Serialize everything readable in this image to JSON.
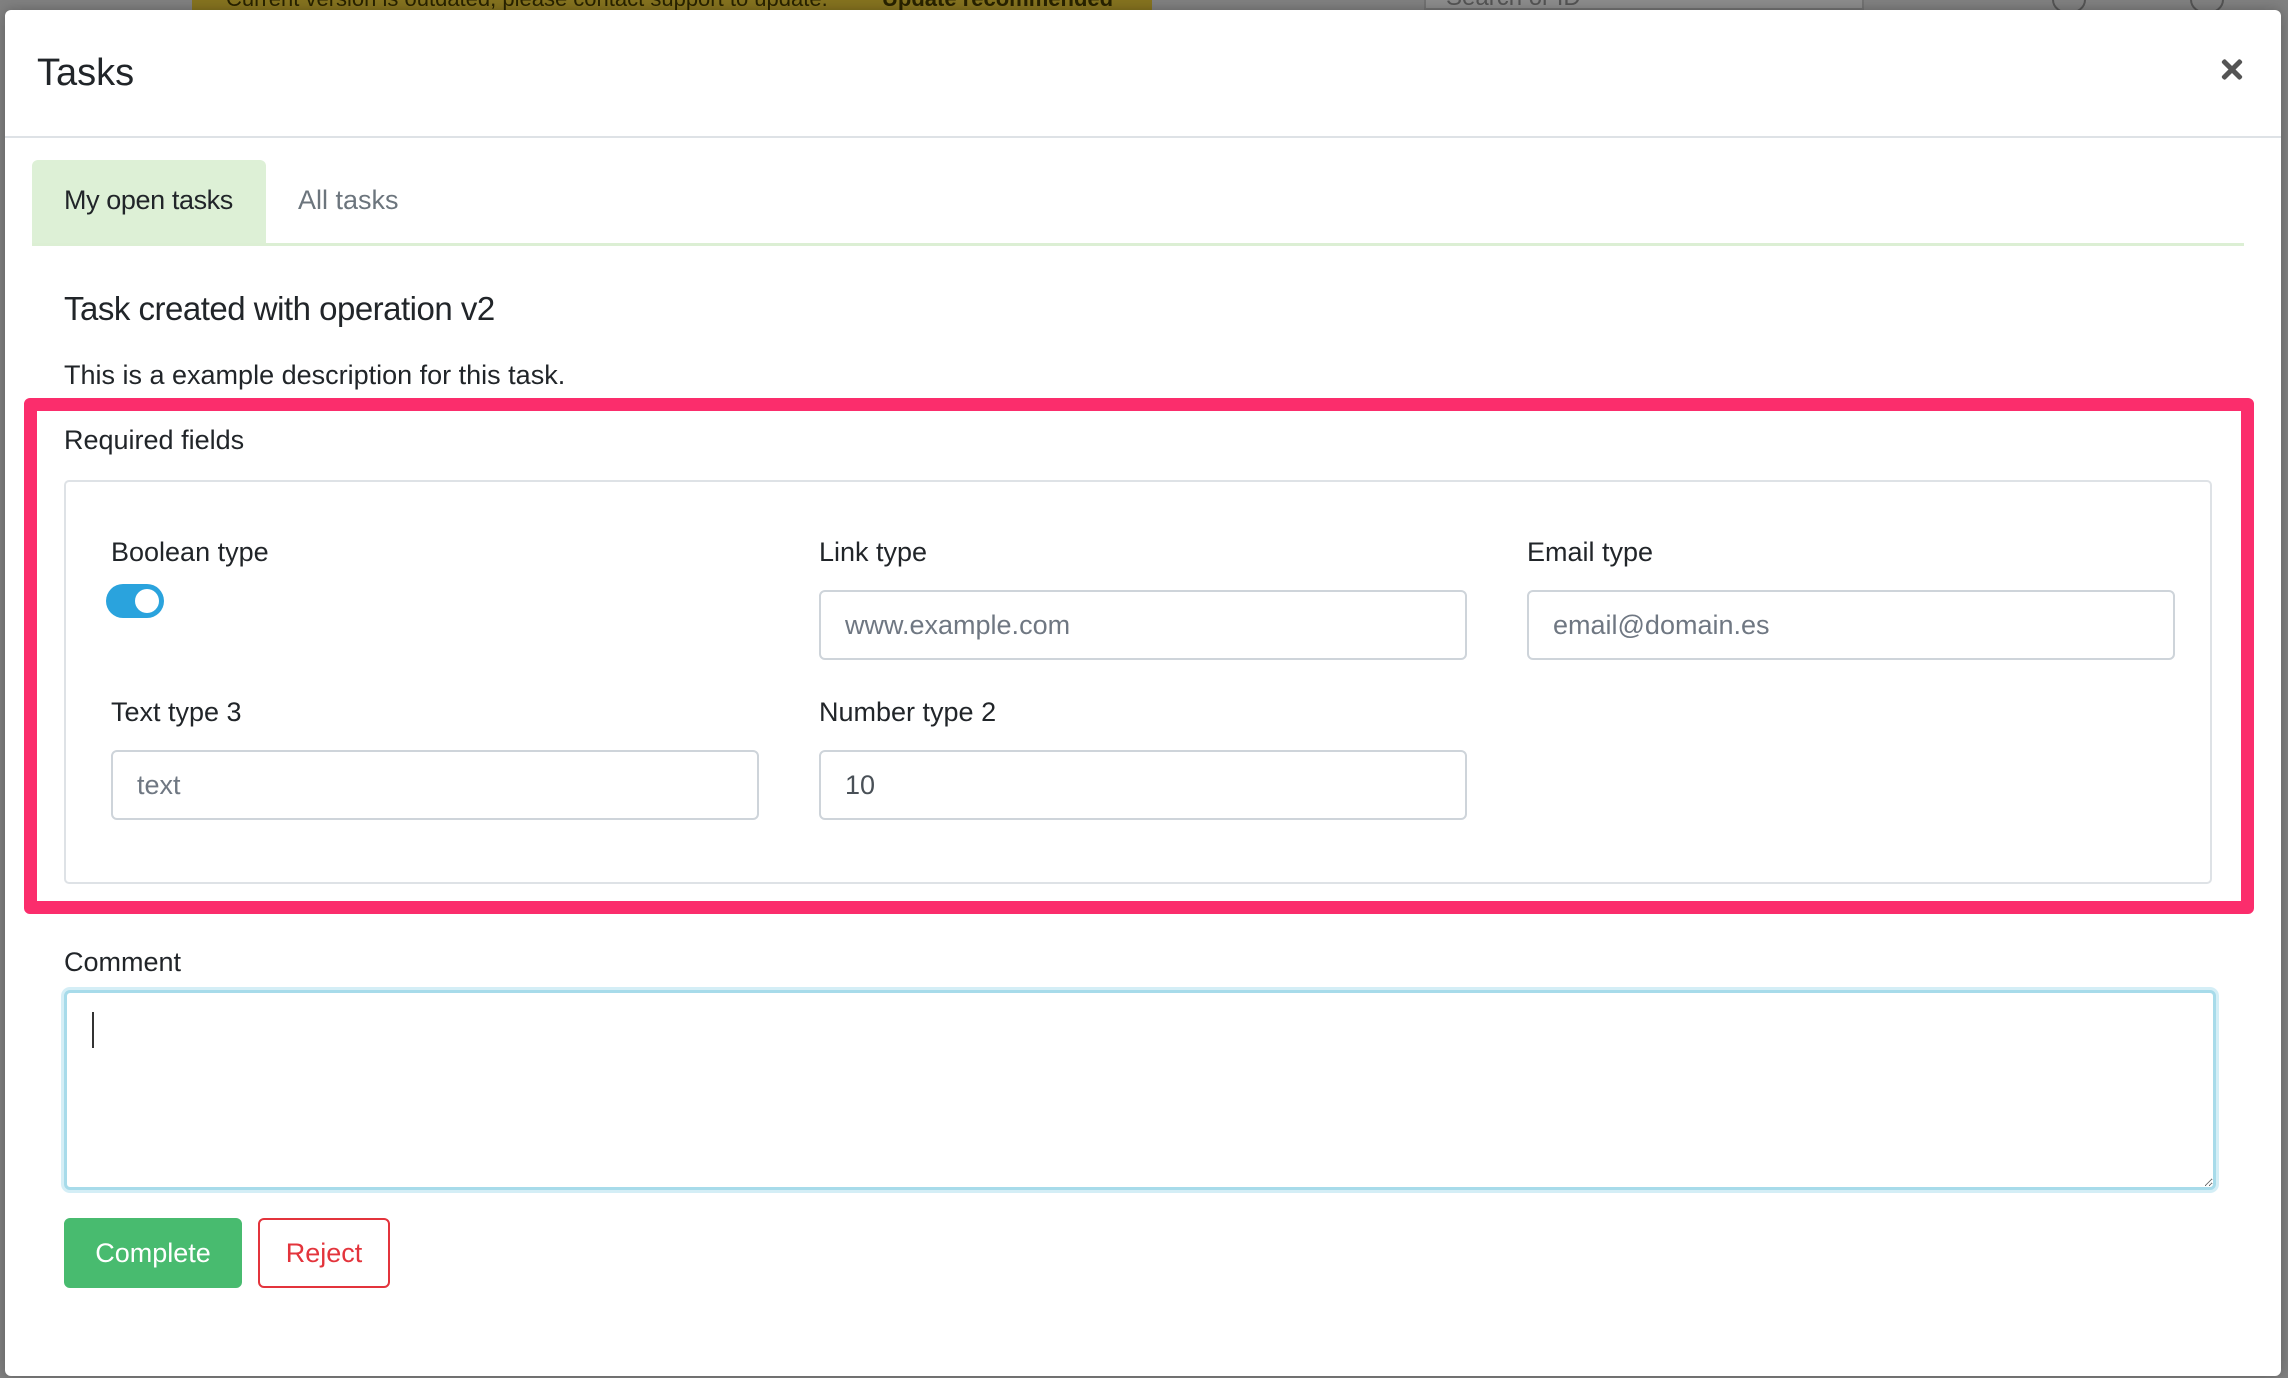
{
  "background": {
    "banner_text": "Current version is outdated, please contact support to update.",
    "banner_badge": "Update recommended",
    "search_placeholder": "Search or ID"
  },
  "modal": {
    "title": "Tasks",
    "close_icon": "close-icon"
  },
  "tabs": [
    {
      "label": "My open tasks",
      "active": true
    },
    {
      "label": "All tasks",
      "active": false
    }
  ],
  "task": {
    "title": "Task created with operation v2",
    "description": "This is a example description for this task."
  },
  "required_fields": {
    "label": "Required fields",
    "boolean_field": {
      "label": "Boolean type",
      "value": true
    },
    "link_field": {
      "label": "Link type",
      "placeholder": "www.example.com",
      "value": ""
    },
    "email_field": {
      "label": "Email type",
      "placeholder": "email@domain.es",
      "value": ""
    },
    "text_field": {
      "label": "Text type 3",
      "placeholder": "text",
      "value": ""
    },
    "number_field": {
      "label": "Number type 2",
      "placeholder": "",
      "value": "10"
    }
  },
  "comment": {
    "label": "Comment",
    "value": ""
  },
  "actions": {
    "complete_label": "Complete",
    "reject_label": "Reject"
  },
  "colors": {
    "highlight": "#fb2d6c",
    "complete_button": "#48bb6f",
    "reject_button": "#e3343c",
    "toggle_on": "#2aa3dd",
    "active_tab": "#ddf0d6"
  }
}
